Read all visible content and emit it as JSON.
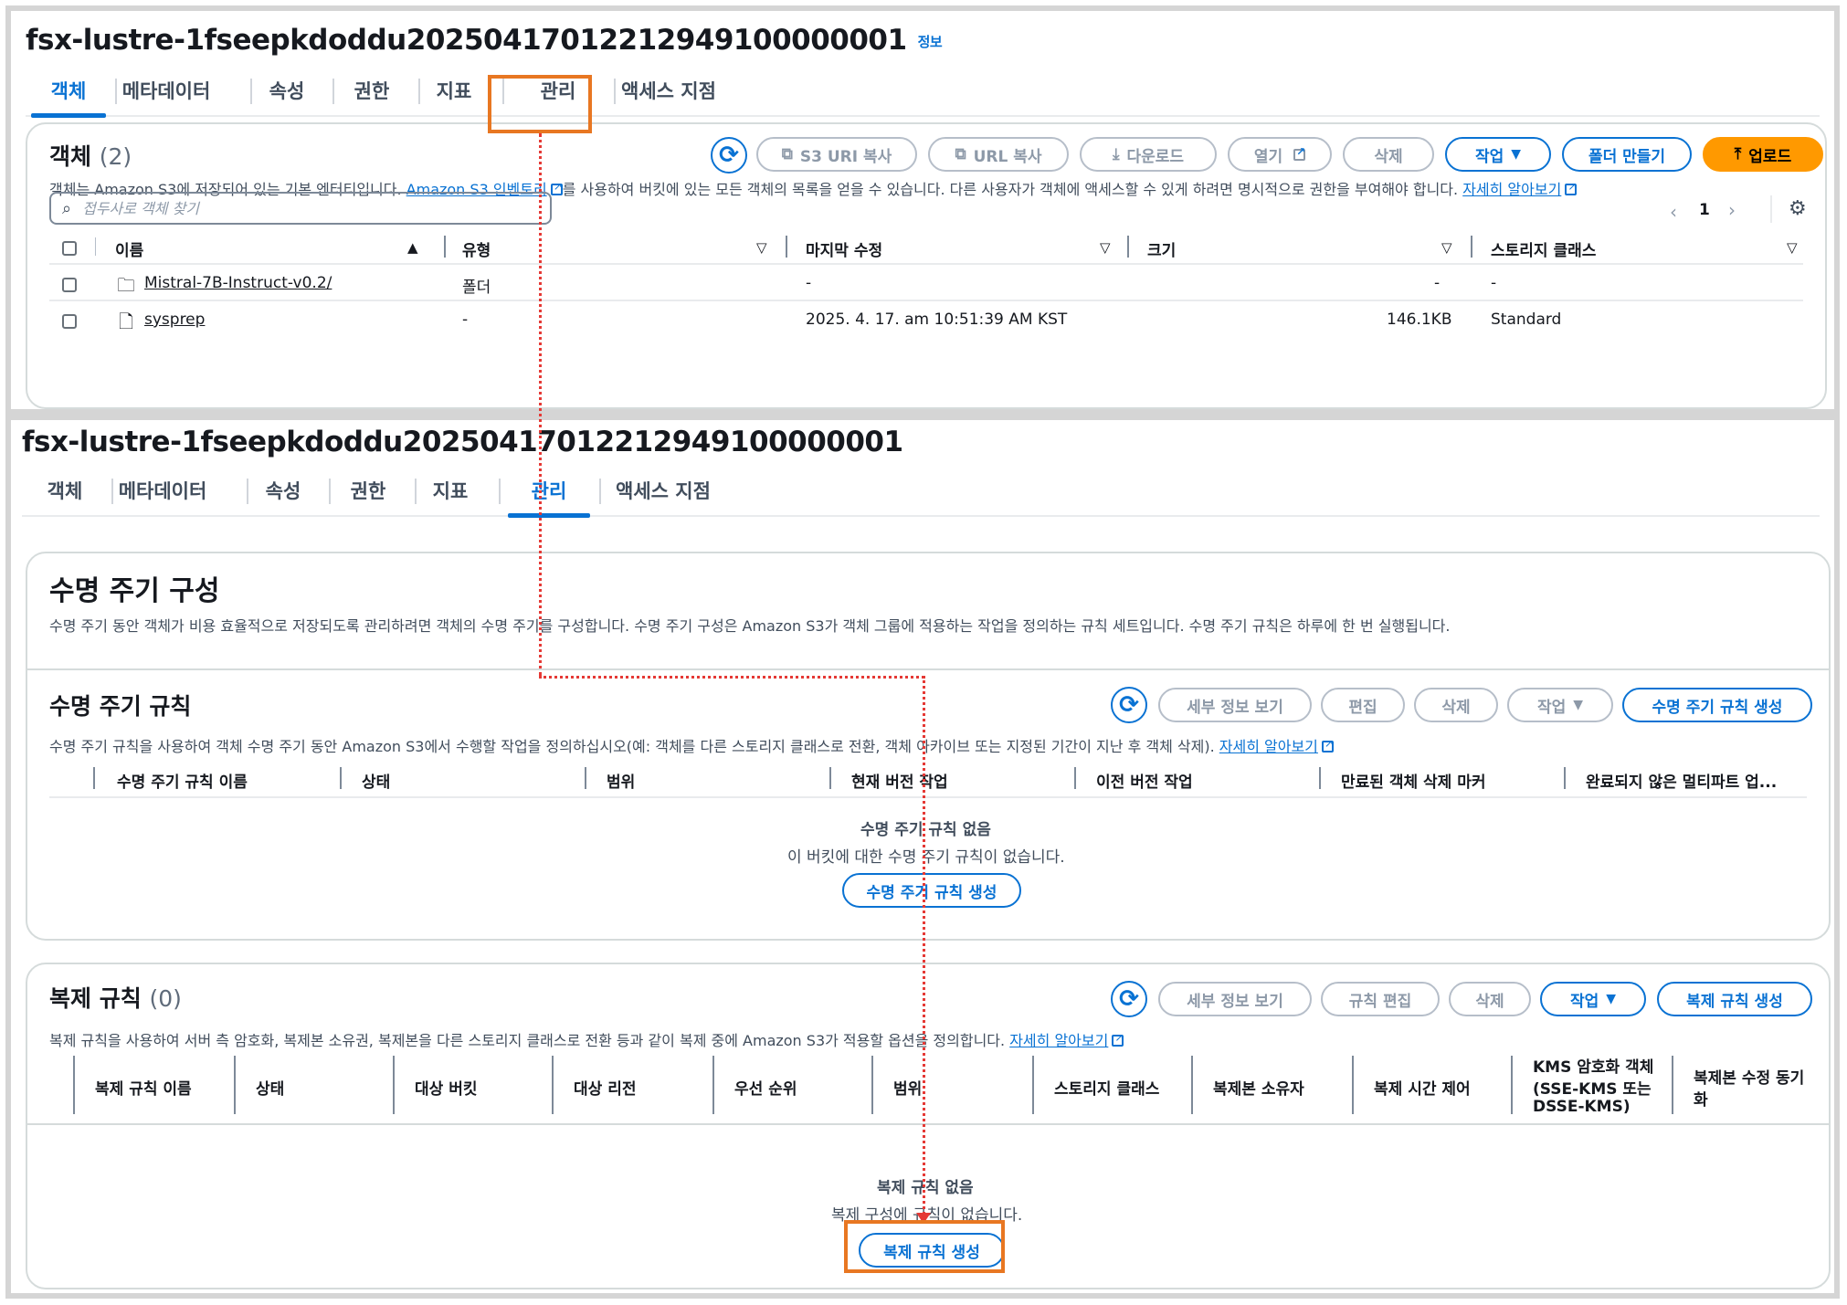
{
  "top": {
    "bucket_name": "fsx-lustre-1fseepkdoddu20250417012212949100000001",
    "info_link": "정보",
    "tabs": [
      "객체",
      "메타데이터",
      "속성",
      "권한",
      "지표",
      "관리",
      "액세스 지점"
    ],
    "active_tab": "객체",
    "objects": {
      "title": "객체",
      "count": "(2)",
      "buttons": {
        "copy_s3_uri": "S3 URI 복사",
        "copy_url": "URL 복사",
        "download": "다운로드",
        "open": "열기",
        "delete": "삭제",
        "actions": "작업",
        "create_folder": "폴더 만들기",
        "upload": "업로드"
      },
      "description_part1": "객체는 Amazon S3에 저장되어 있는 기본 엔터티입니다.",
      "inventory_link": "Amazon S3 인벤토리",
      "description_part2": "를 사용하여 버킷에 있는 모든 객체의 목록을 얻을 수 있습니다. 다른 사용자가 객체에 액세스할 수 있게 하려면 명시적으로 권한을 부여해야 합니다.",
      "learn_more": "자세히 알아보기",
      "search_placeholder": "접두사로 객체 찾기",
      "page_number": "1",
      "columns": [
        "이름",
        "유형",
        "마지막 수정",
        "크기",
        "스토리지 클래스"
      ],
      "rows": [
        {
          "name": "Mistral-7B-Instruct-v0.2/",
          "type": "폴더",
          "modified": "-",
          "size": "-",
          "storage": "-"
        },
        {
          "name": "sysprep",
          "type": "-",
          "modified": "2025. 4. 17. am 10:51:39 AM KST",
          "size": "146.1KB",
          "storage": "Standard"
        }
      ]
    }
  },
  "bottom": {
    "bucket_name": "fsx-lustre-1fseepkdoddu20250417012212949100000001",
    "tabs": [
      "객체",
      "메타데이터",
      "속성",
      "권한",
      "지표",
      "관리",
      "액세스 지점"
    ],
    "active_tab": "관리",
    "lifecycle_config": {
      "title": "수명 주기 구성",
      "description": "수명 주기 동안 객체가 비용 효율적으로 저장되도록 관리하려면 객체의 수명 주기를 구성합니다. 수명 주기 구성은 Amazon S3가 객체 그룹에 적용하는 작업을 정의하는 규칙 세트입니다. 수명 주기 규칙은 하루에 한 번 실행됩니다."
    },
    "lifecycle_rules": {
      "title": "수명 주기 규칙",
      "buttons": {
        "view_details": "세부 정보 보기",
        "edit": "편집",
        "delete": "삭제",
        "actions": "작업",
        "create": "수명 주기 규칙 생성"
      },
      "description": "수명 주기 규칙을 사용하여 객체 수명 주기 동안 Amazon S3에서 수행할 작업을 정의하십시오(예: 객체를 다른 스토리지 클래스로 전환, 객체 아카이브 또는 지정된 기간이 지난 후 객체 삭제).",
      "learn_more": "자세히 알아보기",
      "columns": [
        "수명 주기 규칙 이름",
        "상태",
        "범위",
        "현재 버전 작업",
        "이전 버전 작업",
        "만료된 객체 삭제 마커",
        "완료되지 않은 멀티파트 업..."
      ],
      "empty_title": "수명 주기 규칙 없음",
      "empty_sub": "이 버킷에 대한 수명 주기 규칙이 없습니다.",
      "empty_button": "수명 주기 규칙 생성"
    },
    "replication_rules": {
      "title": "복제 규칙",
      "count": "(0)",
      "buttons": {
        "view_details": "세부 정보 보기",
        "edit_rule": "규칙 편집",
        "delete": "삭제",
        "actions": "작업",
        "create": "복제 규칙 생성"
      },
      "description": "복제 규칙을 사용하여 서버 측 암호화, 복제본 소유권, 복제본을 다른 스토리지 클래스로 전환 등과 같이 복제 중에 Amazon S3가 적용할 옵션을 정의합니다.",
      "learn_more": "자세히 알아보기",
      "columns": [
        "복제 규칙 이름",
        "상태",
        "대상 버킷",
        "대상 리전",
        "우선 순위",
        "범위",
        "스토리지 클래스",
        "복제본 소유자",
        "복제 시간 제어"
      ],
      "col_kms_1": "KMS 암호화 객체",
      "col_kms_2": "(SSE-KMS 또는",
      "col_kms_3": "DSSE-KMS)",
      "col_sync_1": "복제본 수정 동기",
      "col_sync_2": "화",
      "empty_title": "복제 규칙 없음",
      "empty_sub": "복제 구성에 규칙이 없습니다.",
      "empty_button": "복제 규칙 생성"
    }
  },
  "colors": {
    "accent": "#0972d3",
    "highlight": "#e87722",
    "arrow": "#e53935",
    "upload": "#ff9900"
  },
  "icons": [
    "refresh-icon",
    "copy-icon",
    "download-icon",
    "external-link-icon",
    "folder-icon",
    "file-icon",
    "search-icon",
    "settings-icon",
    "upload-icon",
    "caret-down-icon",
    "sort-icon"
  ]
}
